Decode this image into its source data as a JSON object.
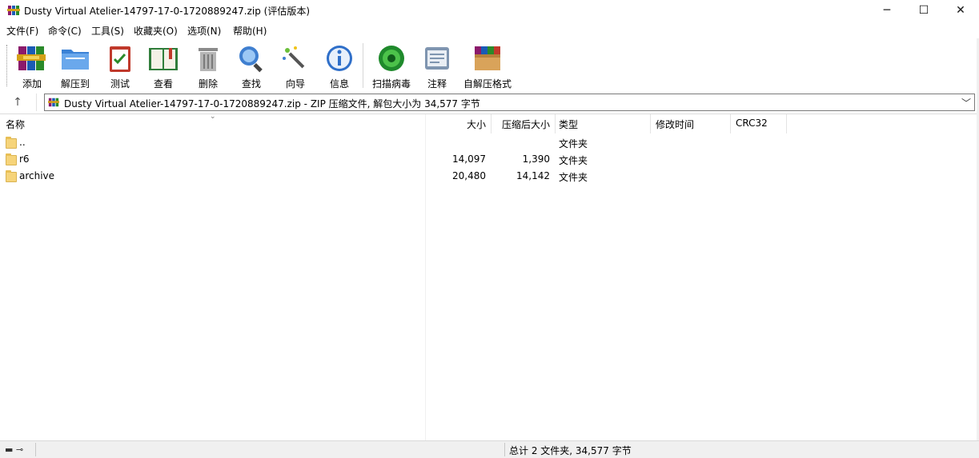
{
  "window": {
    "title": "Dusty Virtual Atelier-14797-17-0-1720889247.zip (评估版本)",
    "minimize": "─",
    "maximize": "☐",
    "close": "✕"
  },
  "menu": [
    "文件(F)",
    "命令(C)",
    "工具(S)",
    "收藏夹(O)",
    "选项(N)",
    "帮助(H)"
  ],
  "toolbar": {
    "add": "添加",
    "extract": "解压到",
    "test": "测试",
    "view": "查看",
    "delete": "删除",
    "find": "查找",
    "wizard": "向导",
    "info": "信息",
    "virus": "扫描病毒",
    "comment": "注释",
    "sfx": "自解压格式"
  },
  "address": {
    "up_icon": "↑",
    "text": "Dusty Virtual Atelier-14797-17-0-1720889247.zip - ZIP 压缩文件, 解包大小为 34,577 字节",
    "dropdown": "﹀"
  },
  "columns": {
    "name": "名称",
    "size": "大小",
    "packed": "压缩后大小",
    "type": "类型",
    "modified": "修改时间",
    "crc": "CRC32"
  },
  "rows": [
    {
      "name": "..",
      "size": "",
      "packed": "",
      "type": "文件夹"
    },
    {
      "name": "r6",
      "size": "14,097",
      "packed": "1,390",
      "type": "文件夹"
    },
    {
      "name": "archive",
      "size": "20,480",
      "packed": "14,142",
      "type": "文件夹"
    }
  ],
  "status": {
    "text": "总计 2 文件夹, 34,577 字节",
    "icons": "▬ ⊸"
  },
  "colors": {
    "folder": "#f6d47a",
    "status_bg": "#f0f0f0"
  }
}
